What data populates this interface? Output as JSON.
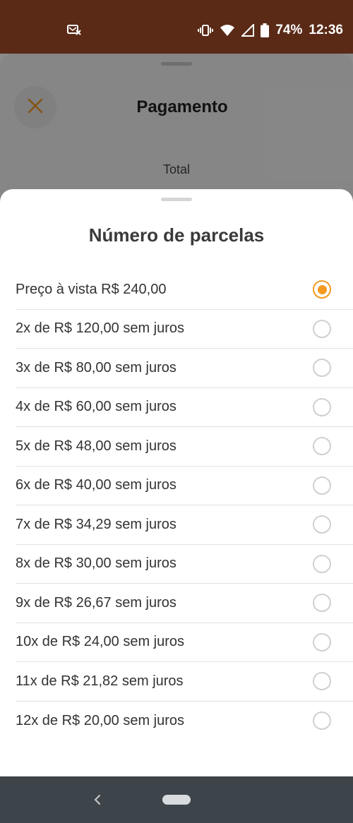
{
  "status_bar": {
    "notification_icon": "message-x-icon",
    "battery_percent": "74%",
    "time": "12:36"
  },
  "background_page": {
    "title": "Pagamento",
    "total_label": "Total",
    "accent": "#f39a1f"
  },
  "sheet": {
    "title": "Número de parcelas",
    "options": [
      {
        "label": "Preço à vista R$ 240,00",
        "selected": true
      },
      {
        "label": "2x de R$ 120,00 sem juros",
        "selected": false
      },
      {
        "label": "3x de R$ 80,00 sem juros",
        "selected": false
      },
      {
        "label": "4x de R$ 60,00 sem juros",
        "selected": false
      },
      {
        "label": "5x de R$ 48,00 sem juros",
        "selected": false
      },
      {
        "label": "6x de R$ 40,00 sem juros",
        "selected": false
      },
      {
        "label": "7x de R$ 34,29 sem juros",
        "selected": false
      },
      {
        "label": "8x de R$ 30,00 sem juros",
        "selected": false
      },
      {
        "label": "9x de R$ 26,67 sem juros",
        "selected": false
      },
      {
        "label": "10x de R$ 24,00 sem juros",
        "selected": false
      },
      {
        "label": "11x de R$ 21,82 sem juros",
        "selected": false
      },
      {
        "label": "12x de R$ 20,00 sem juros",
        "selected": false
      }
    ]
  },
  "colors": {
    "status_bar": "#5a2a17",
    "accent": "#f39a1f",
    "nav_bar": "#3d454b"
  }
}
